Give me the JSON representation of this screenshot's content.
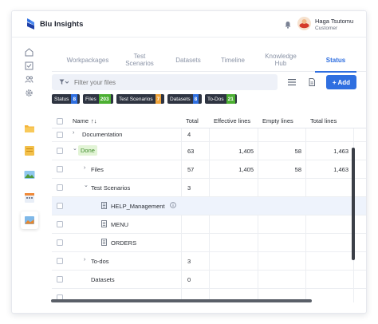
{
  "app": {
    "name": "Blu Insights"
  },
  "user": {
    "name": "Haga Tsutomu",
    "role": "Customer"
  },
  "tabs": [
    {
      "label": "Workpackages",
      "active": false
    },
    {
      "label": "Test Scenarios",
      "active": false
    },
    {
      "label": "Datasets",
      "active": false
    },
    {
      "label": "Timeline",
      "active": false
    },
    {
      "label": "Knowledge Hub",
      "active": false
    },
    {
      "label": "Status",
      "active": true
    }
  ],
  "search": {
    "placeholder": "Filter your files"
  },
  "toolbar": {
    "add_label": "+ Add"
  },
  "chips": [
    {
      "label": "Status",
      "count": "8",
      "color": "#2f6fe0"
    },
    {
      "label": "Files",
      "count": "203",
      "color": "#4caf32"
    },
    {
      "label": "Test Scenarios",
      "count": "7",
      "color": "#f0a43a"
    },
    {
      "label": "Datasets",
      "count": "8",
      "color": "#2f6fe0"
    },
    {
      "label": "To-Dos",
      "count": "21",
      "color": "#4caf32"
    }
  ],
  "table": {
    "columns": {
      "name": "Name",
      "sort_icon": "↑↓",
      "total": "Total",
      "effective": "Effective lines",
      "empty": "Empty lines",
      "total_lines": "Total lines"
    },
    "rows": [
      {
        "name": "Documentation",
        "toggle": "›",
        "total": "4",
        "effective": "",
        "empty": "",
        "total_lines": ""
      },
      {
        "name": "Done",
        "toggle": "⌄",
        "total": "63",
        "effective": "1,405",
        "empty": "58",
        "total_lines": "1,463"
      },
      {
        "name": "Files",
        "toggle": "›",
        "total": "57",
        "effective": "1,405",
        "empty": "58",
        "total_lines": "1,463"
      },
      {
        "name": "Test Scenarios",
        "toggle": "⌄",
        "total": "3",
        "effective": "",
        "empty": "",
        "total_lines": ""
      },
      {
        "name": "HELP_Management",
        "toggle": "",
        "total": "",
        "effective": "",
        "empty": "",
        "total_lines": ""
      },
      {
        "name": "MENU",
        "toggle": "",
        "total": "",
        "effective": "",
        "empty": "",
        "total_lines": ""
      },
      {
        "name": "ORDERS",
        "toggle": "",
        "total": "",
        "effective": "",
        "empty": "",
        "total_lines": ""
      },
      {
        "name": "To-dos",
        "toggle": "›",
        "total": "3",
        "effective": "",
        "empty": "",
        "total_lines": ""
      },
      {
        "name": "Datasets",
        "toggle": "",
        "total": "0",
        "effective": "",
        "empty": "",
        "total_lines": ""
      }
    ]
  },
  "colors": {
    "accent": "#2f6fe0",
    "done_bg": "#e2f4d6",
    "done_text": "#3d8a2a",
    "highlight_row": "#eef3fc"
  },
  "icons": [
    "bell-icon",
    "home-icon",
    "checklist-icon",
    "users-icon",
    "gear-icon",
    "filter-icon",
    "list-view-icon",
    "document-icon",
    "info-icon"
  ]
}
